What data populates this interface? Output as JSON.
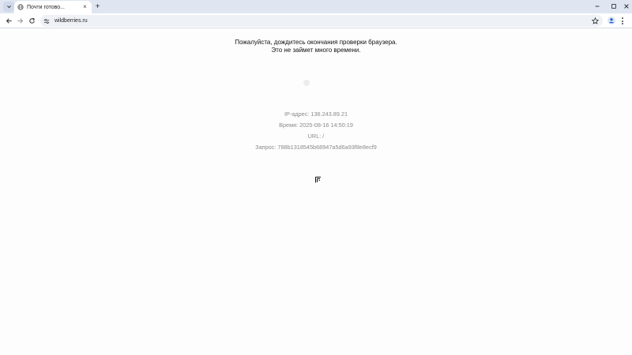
{
  "browser": {
    "tab": {
      "title": "Почти готово...",
      "close_glyph": "×"
    },
    "new_tab_glyph": "+",
    "address": {
      "url": "wildberries.ru"
    },
    "icons": {
      "tab_search": "chevron-down-icon",
      "favicon": "globe-icon",
      "back": "arrow-left-icon",
      "forward": "arrow-right-icon",
      "reload": "reload-icon",
      "site_info": "tune-icon",
      "bookmark": "star-icon",
      "profile": "person-icon",
      "menu": "kebab-menu-icon",
      "minimize": "minimize-icon",
      "maximize": "maximize-icon",
      "close": "close-icon"
    }
  },
  "page": {
    "message_line1": "Пожалуйста, дождитесь окончания проверки браузера.",
    "message_line2": "Это не займет много времени.",
    "ip": "IP-адрес: 136.243.89.21",
    "time": "Время: 2025-08-16 14:50:19",
    "url": "URL: /",
    "request": "Запрос: 788b1318545b68947a5d6a93f8e8ecf9"
  },
  "colors": {
    "tabstrip_bg": "#dfe6f2",
    "page_bg": "#fdfdfd",
    "info_text": "#8a8a8a"
  }
}
